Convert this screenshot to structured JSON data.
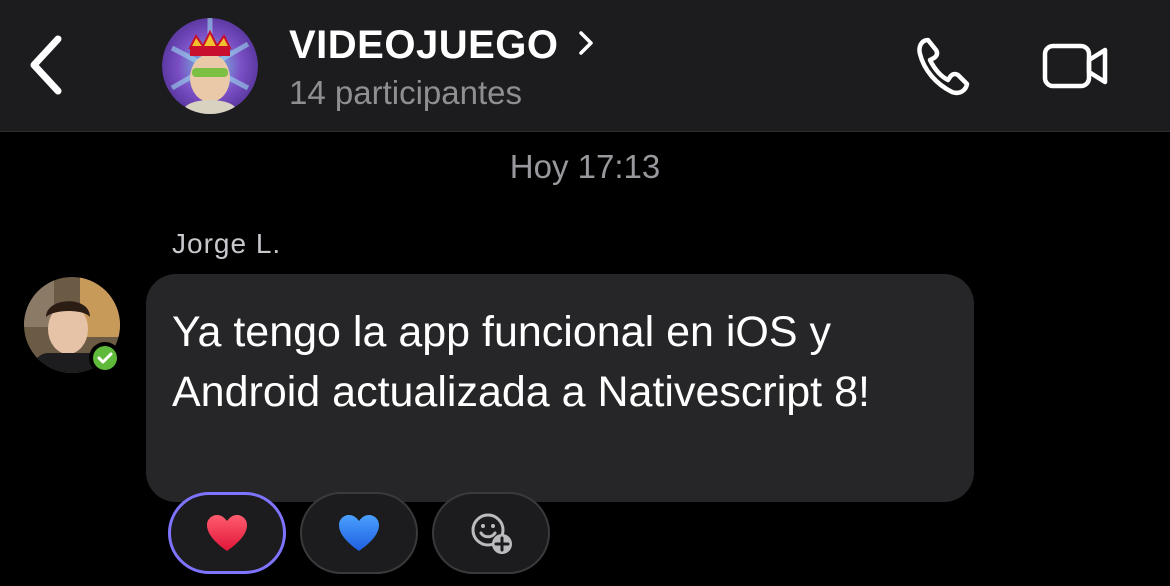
{
  "header": {
    "title": "VIDEOJUEGO",
    "title_chevron": "›",
    "subtitle": "14 participantes",
    "icons": [
      "back-chevron-icon",
      "phone-icon",
      "video-camera-icon"
    ]
  },
  "chat": {
    "timestamp": "Hoy 17:13",
    "message": {
      "sender": "Jorge L.",
      "text": "Ya tengo la app funcional en iOS y Android actualizada a Nativescript 8!",
      "sender_status": "online-check-badge"
    },
    "reactions": [
      {
        "icon": "red-heart-icon",
        "selected": true
      },
      {
        "icon": "blue-heart-icon",
        "selected": false
      },
      {
        "icon": "add-reaction-icon",
        "selected": false
      }
    ]
  },
  "colors": {
    "background": "#000000",
    "header_bg": "#1c1c1e",
    "bubble_bg": "#262628",
    "secondary_text": "#8e8e93",
    "selected_ring": "#7f74ff",
    "online_badge": "#5fb93b"
  }
}
